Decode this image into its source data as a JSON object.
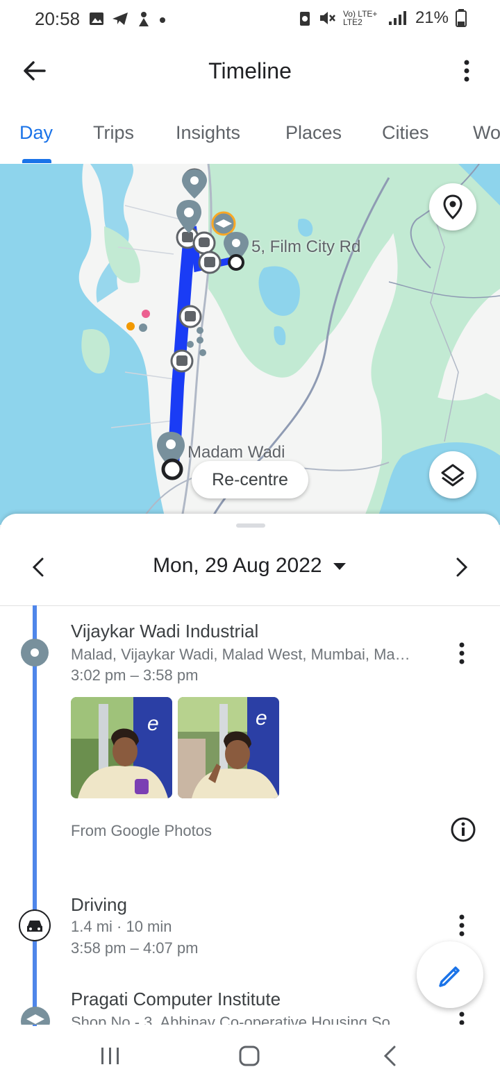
{
  "status_bar": {
    "time": "20:58",
    "battery": "21%",
    "network": "Vo) LTE+ LTE2"
  },
  "app_bar": {
    "title": "Timeline"
  },
  "tabs": [
    {
      "label": "Day"
    },
    {
      "label": "Trips"
    },
    {
      "label": "Insights"
    },
    {
      "label": "Places"
    },
    {
      "label": "Cities"
    },
    {
      "label": "Wo"
    }
  ],
  "map": {
    "label_film_city": "5, Film City Rd",
    "label_madam_wadi": "Madam Wadi",
    "recentre_label": "Re-centre"
  },
  "date_nav": {
    "date": "Mon, 29 Aug 2022"
  },
  "timeline": [
    {
      "title": "Vijaykar Wadi Industrial",
      "address": "Malad, Vijaykar Wadi, Malad West, Mumbai, Ma…",
      "time": "3:02 pm – 3:58 pm",
      "photos_source": "From Google Photos"
    },
    {
      "title": "Driving",
      "distance": "1.4 mi · 10 min",
      "time": "3:58 pm – 4:07 pm"
    },
    {
      "title": "Pragati Computer Institute",
      "address": "Shop No - 3, Abhinav Co-operative Housing So…"
    }
  ],
  "colors": {
    "accent": "#1a73e8",
    "route": "#1a3cf5",
    "map_water": "#8ed4ec",
    "map_green": "#c2ead3"
  }
}
